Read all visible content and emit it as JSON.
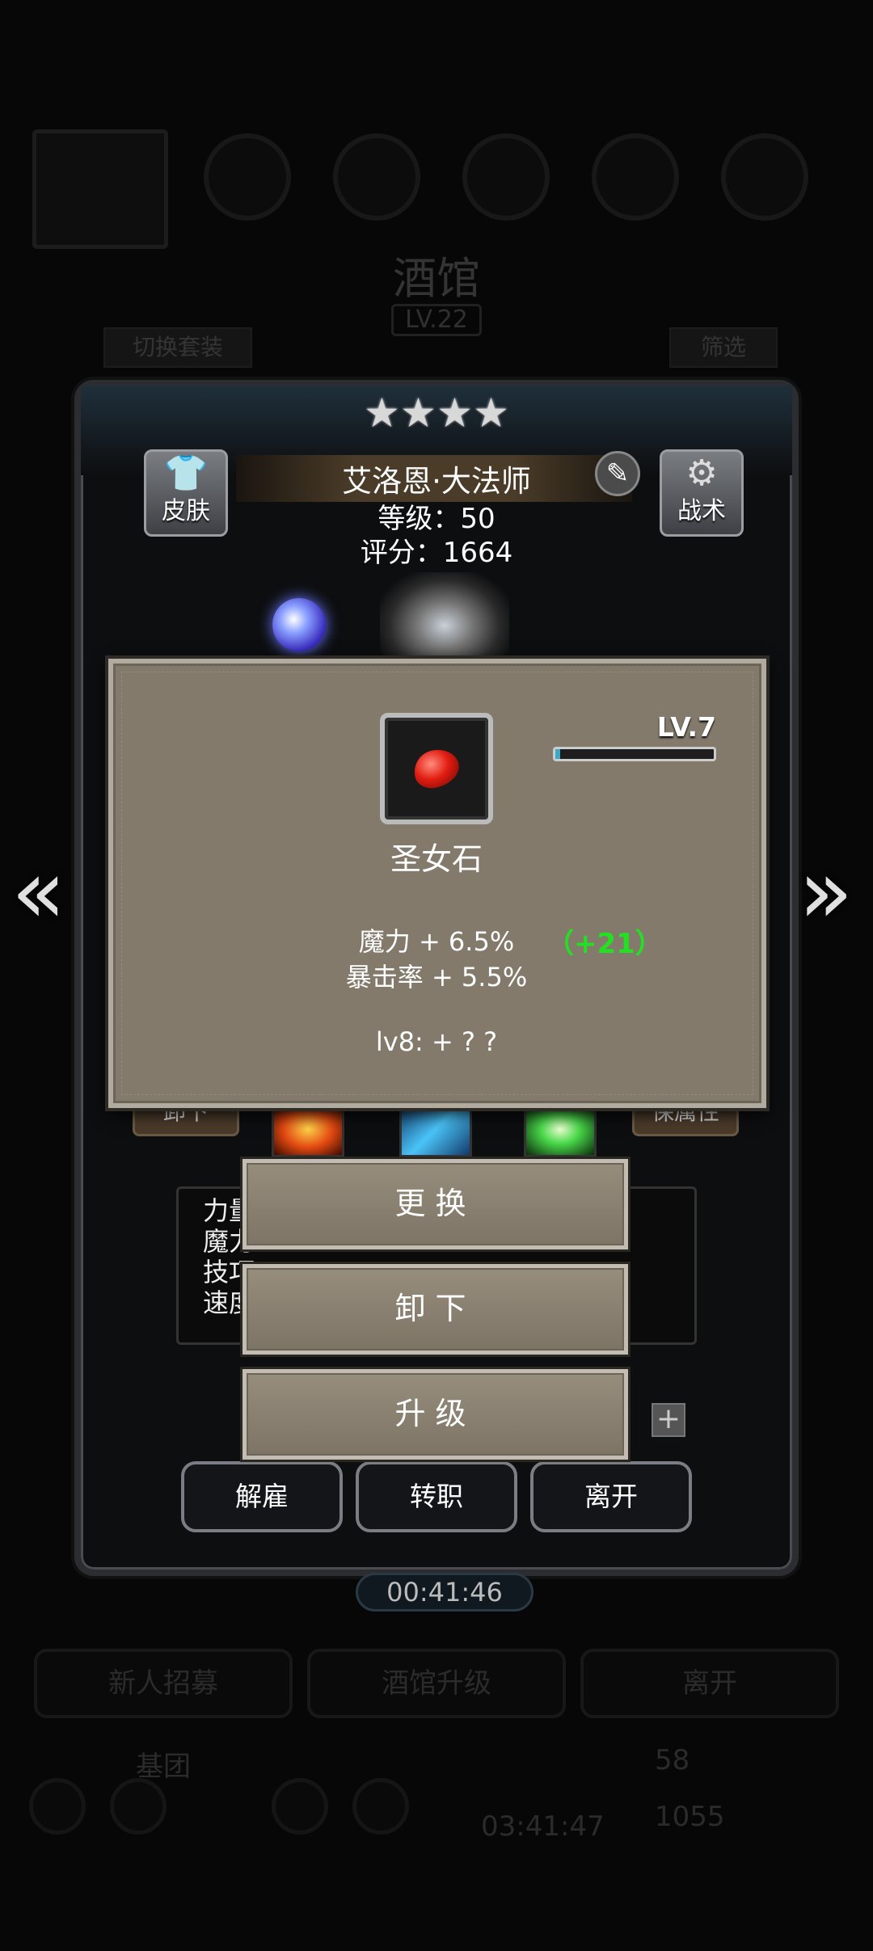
{
  "background": {
    "tavern_title": "酒馆",
    "tavern_level": "LV.22",
    "switch_set": "切换套装",
    "filter": "筛选",
    "timer": "00:41:46",
    "recruit": "新人招募",
    "upgrade_tavern": "酒馆升级",
    "leave": "离开",
    "group": "基团",
    "bottom_timer": "03:41:47",
    "currency_1": "58",
    "currency_2": "1055"
  },
  "hero": {
    "stars": [
      "★",
      "★",
      "★",
      "★"
    ],
    "name": "艾洛恩·大法师",
    "level": "等级：50",
    "score": "评分：1664",
    "skin_label": "皮肤",
    "tactics_label": "战术",
    "unequip_partial": "卸下",
    "hold_partial": "保属性",
    "stats_partial": [
      "力量",
      "魔力",
      "技巧",
      "速度"
    ],
    "fire_button": "解雇",
    "transfer_button": "转职",
    "leave_button": "离开"
  },
  "item_popup": {
    "name": "圣女石",
    "level": "LV.7",
    "xp_fraction": 0.03,
    "magic": "魔力 + 6.5%",
    "magic_bonus": "（+21）",
    "crit": "暴击率 + 5.5%",
    "next_level": "lv8: + ? ?"
  },
  "actions": {
    "replace": "更换",
    "unequip": "卸下",
    "upgrade": "升级"
  },
  "icons": {
    "skin": "shirt-icon",
    "tactics": "gear-icon",
    "edit": "edit-icon",
    "prev": "chevron-left-icon",
    "next": "chevron-right-icon",
    "plus": "plus-icon"
  }
}
